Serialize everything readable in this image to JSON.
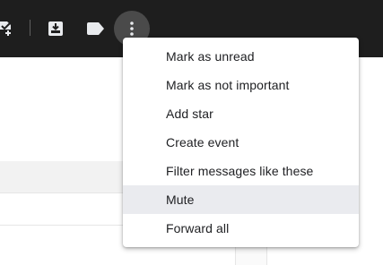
{
  "toolbar": {
    "icons": [
      "add-task-icon",
      "move-to-inbox-icon",
      "label-icon",
      "more-vert-icon"
    ]
  },
  "menu": {
    "items": [
      {
        "label": "Mark as unread",
        "highlighted": false
      },
      {
        "label": "Mark as not important",
        "highlighted": false
      },
      {
        "label": "Add star",
        "highlighted": false
      },
      {
        "label": "Create event",
        "highlighted": false
      },
      {
        "label": "Filter messages like these",
        "highlighted": false
      },
      {
        "label": "Mute",
        "highlighted": true
      },
      {
        "label": "Forward all",
        "highlighted": false
      }
    ]
  },
  "colors": {
    "toolbar_bg": "#1e1e1e",
    "icon": "#e8eaed",
    "menu_hover": "#eaebef",
    "text": "#202124"
  }
}
